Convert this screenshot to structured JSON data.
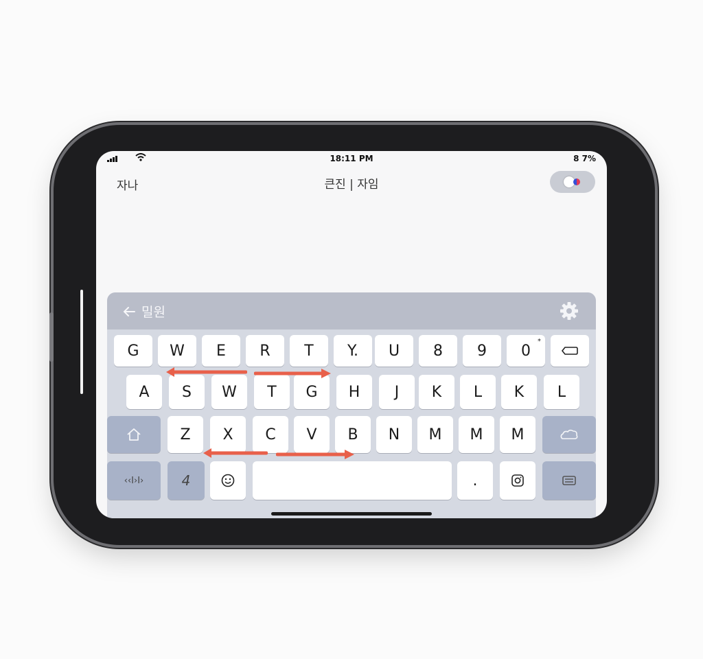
{
  "status_bar": {
    "time": "18:11 PM",
    "battery": "8 7%"
  },
  "header": {
    "left_label": "자나",
    "title": "큰진 | 자임"
  },
  "toggle": {
    "icon": "toggle-switch"
  },
  "keyboard": {
    "toolbar": {
      "back_label": "밀원",
      "back_icon": "arrow-left-icon",
      "settings_icon": "gear-icon"
    },
    "row1": [
      "G",
      "W",
      "E",
      "R",
      "T",
      "Y.",
      "U",
      "8",
      "9",
      "0"
    ],
    "row1_superscript": "*",
    "row2": [
      "A",
      "S",
      "W",
      "T",
      "G",
      "H",
      "J",
      "K",
      "L",
      "K",
      "L"
    ],
    "row3": [
      "Z",
      "X",
      "C",
      "V",
      "B",
      "N",
      "M",
      "M",
      "M"
    ],
    "bottom": {
      "left_fn": "‹‹I›I›",
      "number": "4",
      "period": "."
    },
    "icons": {
      "backspace": "backspace-icon",
      "home": "home-icon",
      "return": "return-icon",
      "emoji": "emoji-icon",
      "camera": "camera-icon",
      "keyboard_hide": "keyboard-hide-icon"
    },
    "gesture_color": "#e8604a",
    "fn_key_color": "#a8b2c8",
    "panel_color": "#d5d9e2"
  }
}
